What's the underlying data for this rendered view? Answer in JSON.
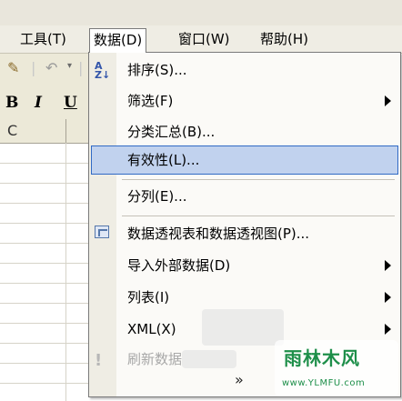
{
  "menubar": {
    "items": [
      {
        "label": "工具(T)"
      },
      {
        "label": "数据(D)"
      },
      {
        "label": "窗口(W)"
      },
      {
        "label": "帮助(H)"
      }
    ]
  },
  "toolbar": {
    "bold": "B",
    "italic": "I",
    "underline": "U"
  },
  "sheet": {
    "column_header": "C"
  },
  "menu": {
    "items": [
      {
        "label": "排序(S)...",
        "submenu": false,
        "icon": "sort-az-icon",
        "enabled": true,
        "highlighted": false
      },
      {
        "label": "筛选(F)",
        "submenu": true,
        "enabled": true,
        "highlighted": false
      },
      {
        "label": "分类汇总(B)...",
        "submenu": false,
        "enabled": true,
        "highlighted": false
      },
      {
        "label": "有效性(L)...",
        "submenu": false,
        "enabled": true,
        "highlighted": true
      },
      {
        "label": "分列(E)...",
        "submenu": false,
        "enabled": true,
        "highlighted": false
      },
      {
        "label": "数据透视表和数据透视图(P)...",
        "submenu": false,
        "icon": "pivot-table-icon",
        "enabled": true,
        "highlighted": false
      },
      {
        "label": "导入外部数据(D)",
        "submenu": true,
        "enabled": true,
        "highlighted": false
      },
      {
        "label": "列表(I)",
        "submenu": true,
        "enabled": true,
        "highlighted": false
      },
      {
        "label": "XML(X)",
        "submenu": true,
        "enabled": true,
        "highlighted": false
      },
      {
        "label": "刷新数据",
        "submenu": false,
        "icon": "refresh-icon",
        "enabled": false,
        "highlighted": false
      }
    ],
    "more": "»"
  },
  "watermark": {
    "title": "雨林木风",
    "url": "www.YLMFU.com"
  },
  "colors": {
    "menubar_bg": "#efede4",
    "highlight_bg": "#c1d2ee",
    "highlight_border": "#316ac5",
    "watermark_green": "#1e8f4a"
  }
}
